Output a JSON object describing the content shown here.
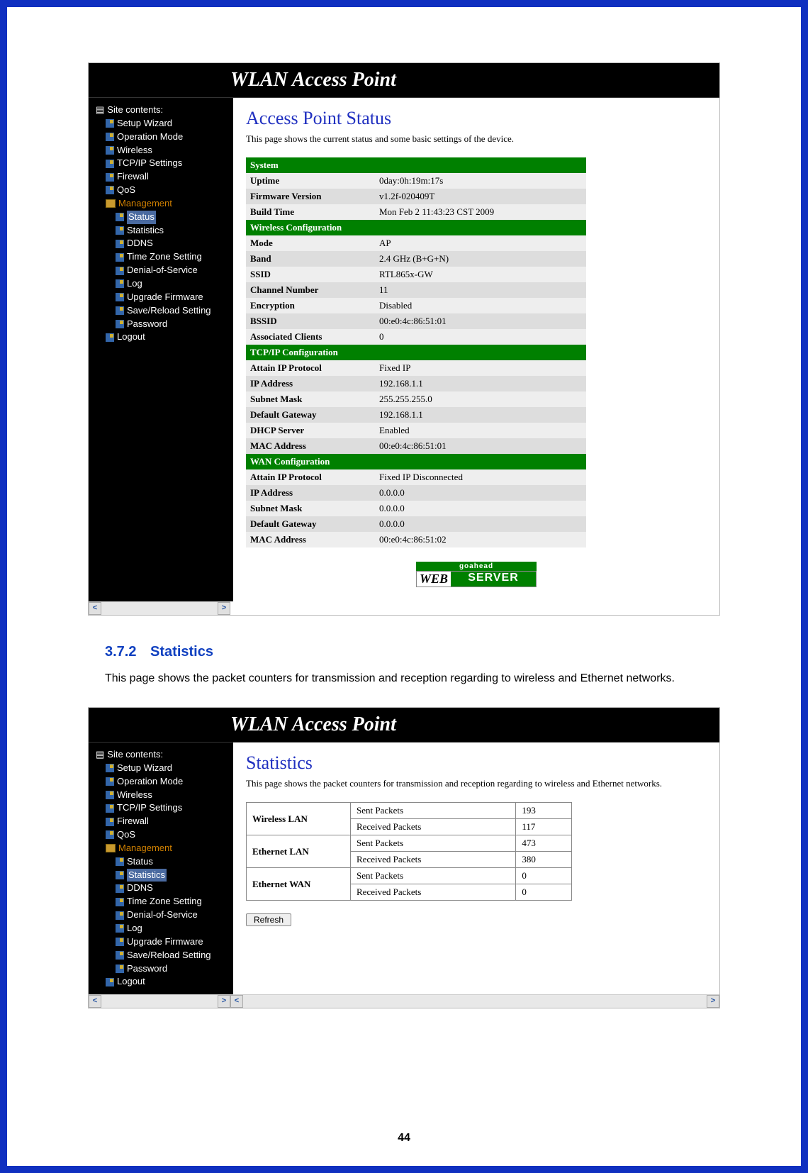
{
  "page_number": "44",
  "banner_title": "WLAN Access Point",
  "sidebar": {
    "root": "Site contents:",
    "items": [
      "Setup Wizard",
      "Operation Mode",
      "Wireless",
      "TCP/IP Settings",
      "Firewall",
      "QoS"
    ],
    "management_label": "Management",
    "mgmt_items": [
      "Status",
      "Statistics",
      "DDNS",
      "Time Zone Setting",
      "Denial-of-Service",
      "Log",
      "Upgrade Firmware",
      "Save/Reload Setting",
      "Password"
    ],
    "logout": "Logout"
  },
  "status_page": {
    "title": "Access Point Status",
    "desc": "This page shows the current status and some basic settings of the device.",
    "sections": {
      "system": {
        "header": "System",
        "rows": [
          [
            "Uptime",
            "0day:0h:19m:17s"
          ],
          [
            "Firmware Version",
            "v1.2f-020409T"
          ],
          [
            "Build Time",
            "Mon Feb 2 11:43:23 CST 2009"
          ]
        ]
      },
      "wireless": {
        "header": "Wireless Configuration",
        "rows": [
          [
            "Mode",
            "AP"
          ],
          [
            "Band",
            "2.4 GHz (B+G+N)"
          ],
          [
            "SSID",
            "RTL865x-GW"
          ],
          [
            "Channel Number",
            "11"
          ],
          [
            "Encryption",
            "Disabled"
          ],
          [
            "BSSID",
            "00:e0:4c:86:51:01"
          ],
          [
            "Associated Clients",
            "0"
          ]
        ]
      },
      "tcpip": {
        "header": "TCP/IP Configuration",
        "rows": [
          [
            "Attain IP Protocol",
            "Fixed IP"
          ],
          [
            "IP Address",
            "192.168.1.1"
          ],
          [
            "Subnet Mask",
            "255.255.255.0"
          ],
          [
            "Default Gateway",
            "192.168.1.1"
          ],
          [
            "DHCP Server",
            "Enabled"
          ],
          [
            "MAC Address",
            "00:e0:4c:86:51:01"
          ]
        ]
      },
      "wan": {
        "header": "WAN Configuration",
        "rows": [
          [
            "Attain IP Protocol",
            "Fixed IP Disconnected"
          ],
          [
            "IP Address",
            "0.0.0.0"
          ],
          [
            "Subnet Mask",
            "0.0.0.0"
          ],
          [
            "Default Gateway",
            "0.0.0.0"
          ],
          [
            "MAC Address",
            "00:e0:4c:86:51:02"
          ]
        ]
      }
    },
    "goahead_top": "goahead",
    "goahead_web": "WEB",
    "goahead_server": "SERVER"
  },
  "doc_section": {
    "num": "3.7.2",
    "title": "Statistics",
    "body": "This page shows the packet counters for transmission and reception regarding to wireless and Ethernet networks."
  },
  "stats_page": {
    "title": "Statistics",
    "desc": "This page shows the packet counters for transmission and reception regarding to wireless and Ethernet networks.",
    "table": {
      "groups": [
        {
          "name": "Wireless LAN",
          "rows": [
            [
              "Sent Packets",
              "193"
            ],
            [
              "Received Packets",
              "117"
            ]
          ]
        },
        {
          "name": "Ethernet LAN",
          "rows": [
            [
              "Sent Packets",
              "473"
            ],
            [
              "Received Packets",
              "380"
            ]
          ]
        },
        {
          "name": "Ethernet WAN",
          "rows": [
            [
              "Sent Packets",
              "0"
            ],
            [
              "Received Packets",
              "0"
            ]
          ]
        }
      ]
    },
    "refresh_label": "Refresh"
  },
  "arrows": {
    "left": "<",
    "right": ">"
  }
}
